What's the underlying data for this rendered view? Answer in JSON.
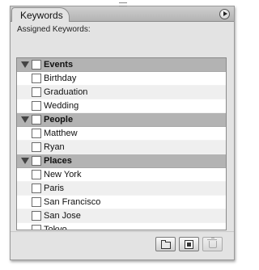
{
  "panel": {
    "tab_label": "Keywords",
    "assigned_label": "Assigned Keywords:"
  },
  "keywords": [
    {
      "type": "category",
      "label": "Events"
    },
    {
      "type": "item",
      "label": "Birthday"
    },
    {
      "type": "item",
      "label": "Graduation"
    },
    {
      "type": "item",
      "label": "Wedding"
    },
    {
      "type": "category",
      "label": "People"
    },
    {
      "type": "item",
      "label": "Matthew"
    },
    {
      "type": "item",
      "label": "Ryan"
    },
    {
      "type": "category",
      "label": "Places"
    },
    {
      "type": "item",
      "label": "New York"
    },
    {
      "type": "item",
      "label": "Paris"
    },
    {
      "type": "item",
      "label": "San Francisco"
    },
    {
      "type": "item",
      "label": "San Jose"
    },
    {
      "type": "item",
      "label": "Tokyo"
    }
  ],
  "footer_buttons": [
    {
      "icon": "new-folder-icon",
      "enabled": true
    },
    {
      "icon": "new-keyword-icon",
      "enabled": true
    },
    {
      "icon": "trash-icon",
      "enabled": false
    }
  ]
}
